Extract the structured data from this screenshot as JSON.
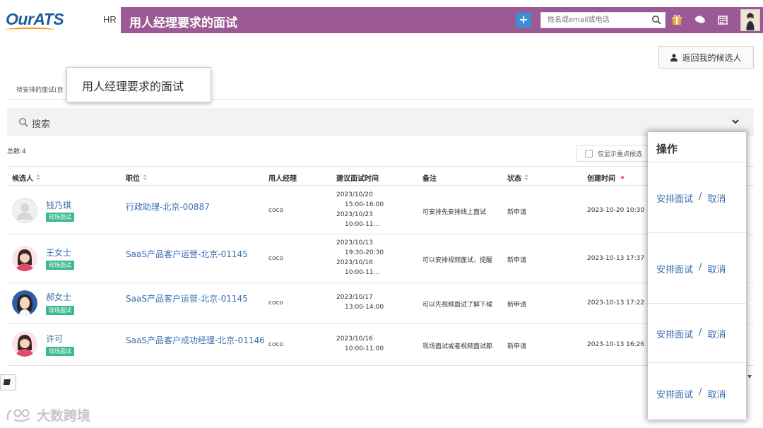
{
  "app": {
    "logo": "OurATS",
    "section": "HR",
    "page_title": "用人经理要求的面试"
  },
  "header": {
    "add_button": "+",
    "search_placeholder": "姓名或email或电话"
  },
  "toolbar": {
    "return_label": "返回我的候选人"
  },
  "tabs": {
    "partial_label": "待安排的面试(自",
    "tooltip": "用人经理要求的面试"
  },
  "search": {
    "label": "搜索"
  },
  "summary": {
    "total": "总数:4",
    "only_key_label": "仅显示重点候选"
  },
  "table": {
    "columns": {
      "candidate": "候选人",
      "position": "职位",
      "manager": "用人经理",
      "suggested_time": "建议面试时间",
      "note": "备注",
      "status": "状态",
      "created": "创建时间"
    },
    "rows": [
      {
        "name": "钱乃琪",
        "tag": "现场面试",
        "position": "行政助理-北京-00887",
        "manager": "coco",
        "times": [
          "2023/10/20",
          "15:00-16:00",
          "2023/10/23",
          "10:00-11..."
        ],
        "note": "可安排先安排线上面试",
        "status": "新申请",
        "created": "2023-10-20 10:30"
      },
      {
        "name": "王女士",
        "tag": "现场面试",
        "position": "SaaS产品客户运营-北京-01145",
        "manager": "coco",
        "times": [
          "2023/10/13",
          "19:30-20:30",
          "2023/10/16",
          "10:00-11..."
        ],
        "note": "可以安排视频面试，提醒",
        "status": "新申请",
        "created": "2023-10-13 17:37"
      },
      {
        "name": "郝女士",
        "tag": "现场面试",
        "position": "SaaS产品客户运营-北京-01145",
        "manager": "coco",
        "times": [
          "2023/10/17",
          "13:00-14:00"
        ],
        "note": "可以先视频面试了解下候",
        "status": "新申请",
        "created": "2023-10-13 17:22"
      },
      {
        "name": "许可",
        "tag": "现场面试",
        "position": "SaaS产品客户成功经理-北京-01146",
        "manager": "coco",
        "times": [
          "2023/10/16",
          "10:00-11:00"
        ],
        "note": "现场面试或者视频面试都",
        "status": "新申请",
        "created": "2023-10-13 16:26"
      }
    ]
  },
  "ops": {
    "title": "操作",
    "schedule": "安排面试",
    "separator": "/",
    "cancel": "取消"
  },
  "watermark": "大数跨境",
  "colors": {
    "topbar": "#9b5a94",
    "link": "#3a6fb0",
    "tag": "#3bb98f",
    "primary_button": "#3c8fd6"
  }
}
